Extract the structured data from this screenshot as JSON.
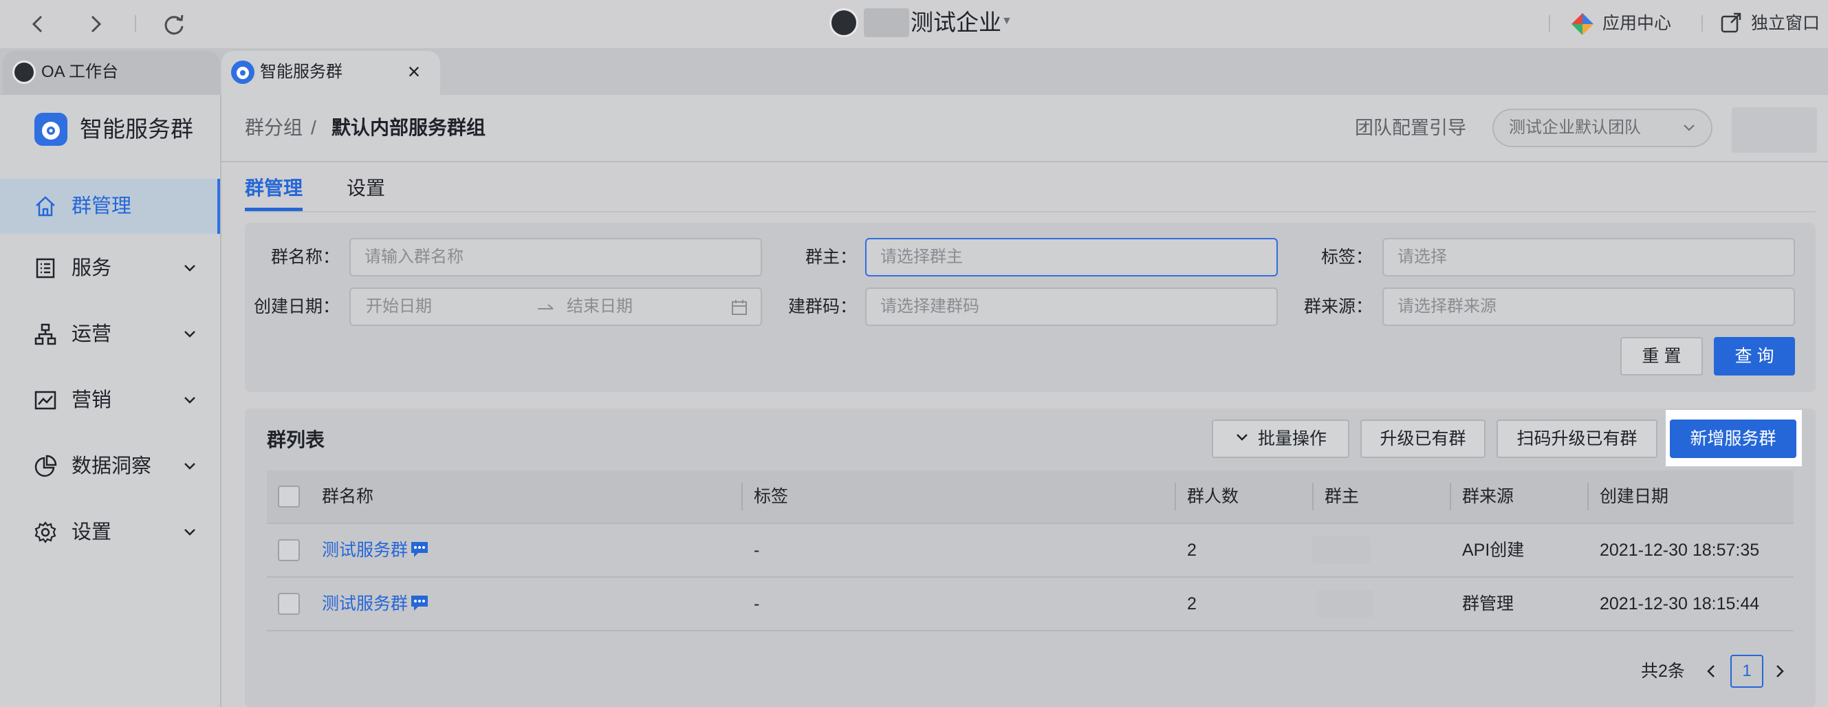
{
  "titlebar": {
    "org_name": "测试企业",
    "app_center": "应用中心",
    "popout": "独立窗口"
  },
  "tabs": [
    {
      "label": "OA 工作台"
    },
    {
      "label": "智能服务群"
    }
  ],
  "sidebar": {
    "brand": "智能服务群",
    "items": [
      {
        "label": "群管理",
        "icon": "home-icon"
      },
      {
        "label": "服务",
        "icon": "list-icon"
      },
      {
        "label": "运营",
        "icon": "org-chart-icon"
      },
      {
        "label": "营销",
        "icon": "line-chart-icon"
      },
      {
        "label": "数据洞察",
        "icon": "pie-chart-icon"
      },
      {
        "label": "设置",
        "icon": "gear-icon"
      }
    ]
  },
  "header": {
    "crumb_parent": "群分组",
    "crumb_sep": "/",
    "crumb_current": "默认内部服务群组",
    "team_guide": "团队配置引导",
    "team_select": "测试企业默认团队"
  },
  "content_tabs": [
    "群管理",
    "设置"
  ],
  "filters": {
    "name_label": "群名称：",
    "name_placeholder": "请输入群名称",
    "owner_label": "群主：",
    "owner_placeholder": "请选择群主",
    "tag_label": "标签：",
    "tag_placeholder": "请选择",
    "date_label": "创建日期：",
    "date_start": "开始日期",
    "date_end": "结束日期",
    "code_label": "建群码：",
    "code_placeholder": "请选择建群码",
    "source_label": "群来源：",
    "source_placeholder": "请选择群来源",
    "reset": "重 置",
    "search": "查 询"
  },
  "list": {
    "title": "群列表",
    "batch": "批量操作",
    "upgrade": "升级已有群",
    "scan_upgrade": "扫码升级已有群",
    "add_new": "新增服务群",
    "columns": [
      "群名称",
      "标签",
      "群人数",
      "群主",
      "群来源",
      "创建日期"
    ],
    "rows": [
      {
        "name": "测试服务群",
        "tag": "-",
        "members": "2",
        "source": "API创建",
        "created": "2021-12-30 18:57:35"
      },
      {
        "name": "测试服务群",
        "tag": "-",
        "members": "2",
        "source": "群管理",
        "created": "2021-12-30 18:15:44"
      }
    ]
  },
  "pagination": {
    "total": "共2条",
    "current": "1"
  },
  "colors": {
    "accent": "#2567d8",
    "highlight": "#ffffff"
  }
}
